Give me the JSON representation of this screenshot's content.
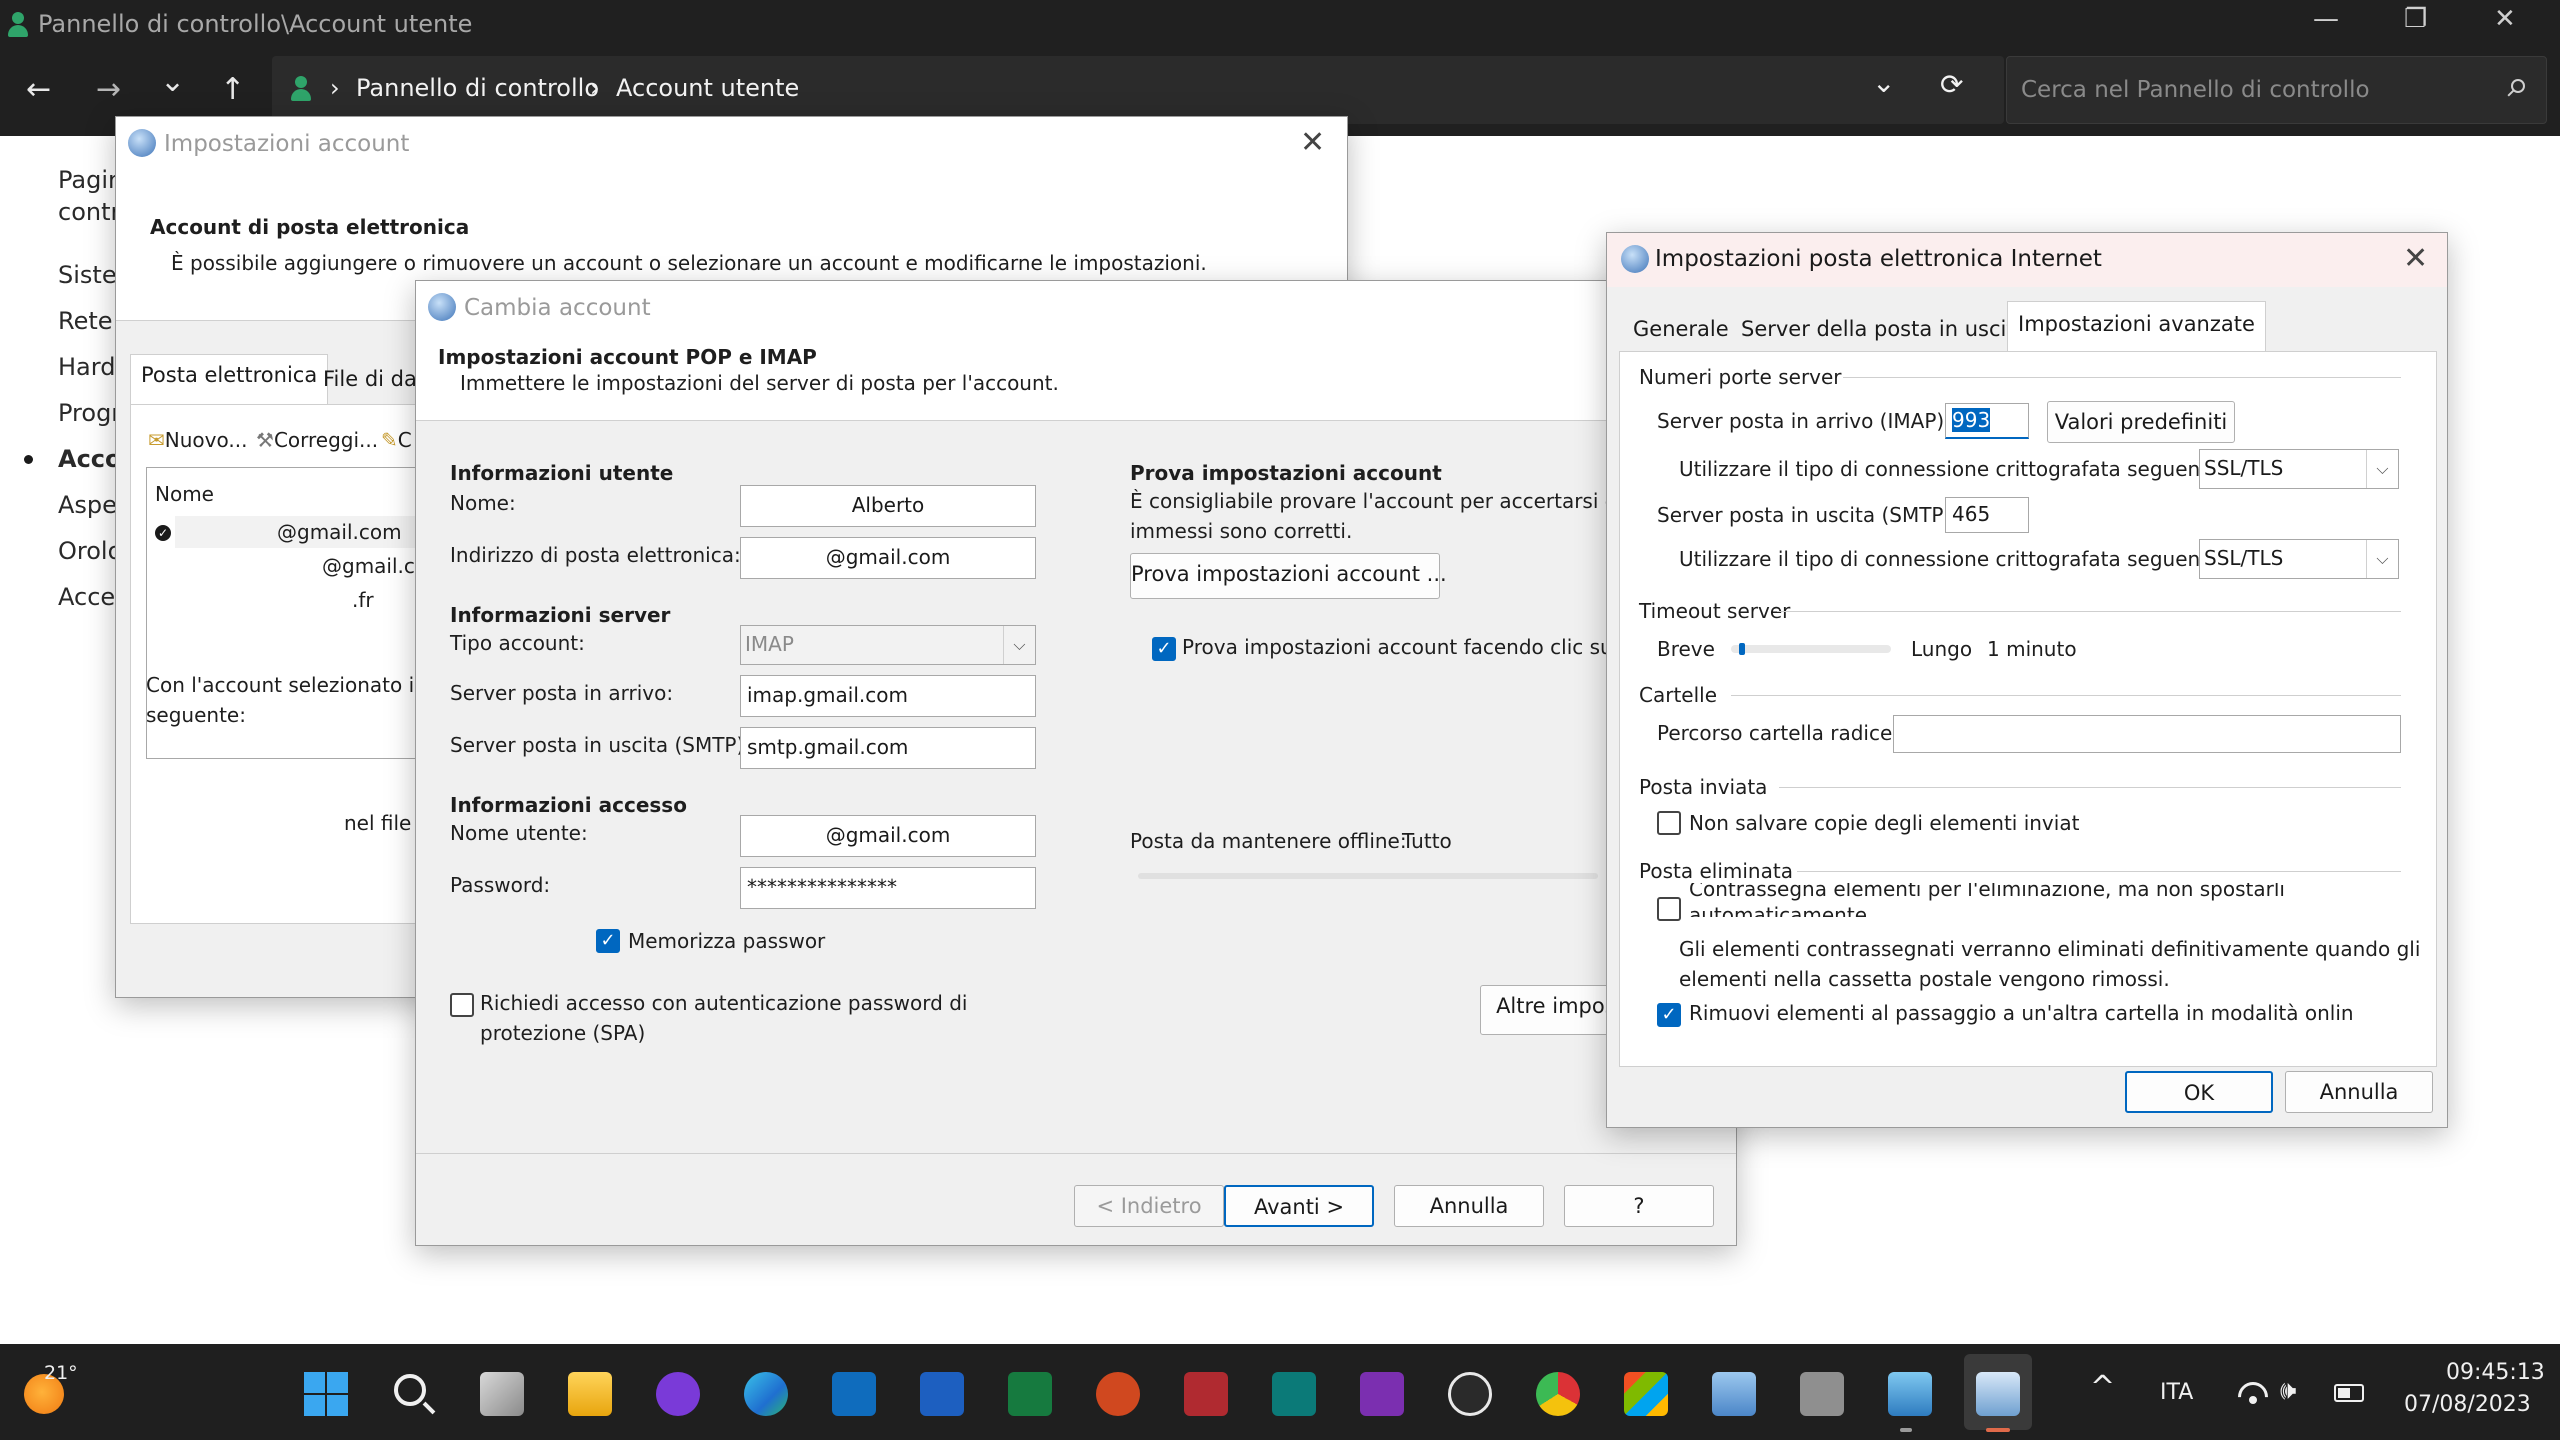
{
  "window": {
    "title": "Pannello di controllo\\Account utente",
    "minimize": "—",
    "maximize": "❐",
    "close": "✕"
  },
  "nav": {
    "back": "←",
    "forward": "→",
    "recent": "⌄",
    "up": "↑",
    "crumbs": [
      "Pannello di controllo",
      "Account utente"
    ],
    "separator": "›",
    "dropdown": "⌄",
    "refresh": "⟳",
    "search_placeholder": "Cerca nel Pannello di controllo"
  },
  "sidebar": {
    "items": [
      "Pagin",
      "contr",
      "Sister",
      "Rete",
      "Hardv",
      "Progr",
      "Acco",
      "Aspet",
      "Orolo",
      "Acces"
    ]
  },
  "account_settings": {
    "title": "Impostazioni account",
    "heading": "Account di posta elettronica",
    "description": "È possibile aggiungere o rimuovere un account o selezionare un account e modificarne le impostazioni.",
    "tabs": [
      "Posta elettronica",
      "File di dati"
    ],
    "toolbar": [
      "Nuovo...",
      "Correggi...",
      "C"
    ],
    "list_header": "Nome",
    "accounts": [
      "@gmail.com",
      "@gmail.com",
      ".fr"
    ],
    "footer_text": "Con l'account selezionato i nu",
    "footer_text2": "seguente:",
    "file_text": "nel file"
  },
  "change_account": {
    "title": "Cambia account",
    "heading": "Impostazioni account POP e IMAP",
    "subheading": "Immettere le impostazioni del server di posta per l'account.",
    "user_info": "Informazioni utente",
    "name_label": "Nome:",
    "name_value": "Alberto",
    "email_label": "Indirizzo di posta elettronica:",
    "email_value": "@gmail.com",
    "server_info": "Informazioni server",
    "account_type_label": "Tipo account:",
    "account_type_value": "IMAP",
    "incoming_label": "Server posta in arrivo:",
    "incoming_value": "imap.gmail.com",
    "outgoing_label": "Server posta in uscita (SMTP):",
    "outgoing_value": "smtp.gmail.com",
    "login_info": "Informazioni accesso",
    "username_label": "Nome utente:",
    "username_value": "@gmail.com",
    "password_label": "Password:",
    "password_value": "***************",
    "remember_password": "Memorizza passwor",
    "spa_line1": "Richiedi accesso con autenticazione password di",
    "spa_line2": "protezione (SPA)",
    "test_heading": "Prova impostazioni account",
    "test_desc1": "È consigliabile provare l'account per accertarsi che i",
    "test_desc2": "immessi sono corretti.",
    "test_button": "Prova impostazioni account ...",
    "test_checkbox": "Prova impostazioni account facendo clic su",
    "offline_label": "Posta da mantenere offline:",
    "offline_value": "Tutto",
    "more_settings": "Altre impost",
    "back_button": "< Indietro",
    "next_button": "Avanti >",
    "cancel_button": "Annulla",
    "help_button": "?"
  },
  "internet_settings": {
    "title": "Impostazioni posta elettronica Internet",
    "tabs": [
      "Generale",
      "Server della posta in uscita",
      "Impostazioni avanzate"
    ],
    "ports_group": "Numeri porte server",
    "imap_label": "Server posta in arrivo (IMAP):",
    "imap_value": "993",
    "defaults_button": "Valori predefiniti",
    "encryption_label": "Utilizzare il tipo di connessione crittografata seguente:",
    "encryption_value": "SSL/TLS",
    "smtp_label": "Server posta in uscita (SMTP):",
    "smtp_value": "465",
    "timeout_group": "Timeout server",
    "timeout_short": "Breve",
    "timeout_long": "Lungo",
    "timeout_value": "1 minuto",
    "timeout_level": 0.05,
    "folders_group": "Cartelle",
    "root_folder_label": "Percorso cartella radice:",
    "root_folder_value": "",
    "sent_group": "Posta inviata",
    "no_save_copies": "Non salvare copie degli elementi inviat",
    "deleted_group": "Posta eliminata",
    "mark_delete_1": "Contrassegna elementi per l'eliminazione, ma non spostarli",
    "mark_delete_2": "automaticamente",
    "purge_info_1": "Gli elementi contrassegnati verranno eliminati definitivamente quando gli",
    "purge_info_2": "elementi nella cassetta postale vengono rimossi.",
    "purge_online": "Rimuovi elementi al passaggio a un'altra cartella in modalità onlin",
    "ok_button": "OK",
    "cancel_button": "Annulla"
  },
  "taskbar": {
    "weather_temp": "21°",
    "chevron": "^",
    "language": "ITA",
    "time": "09:45:13",
    "date": "07/08/2023"
  }
}
